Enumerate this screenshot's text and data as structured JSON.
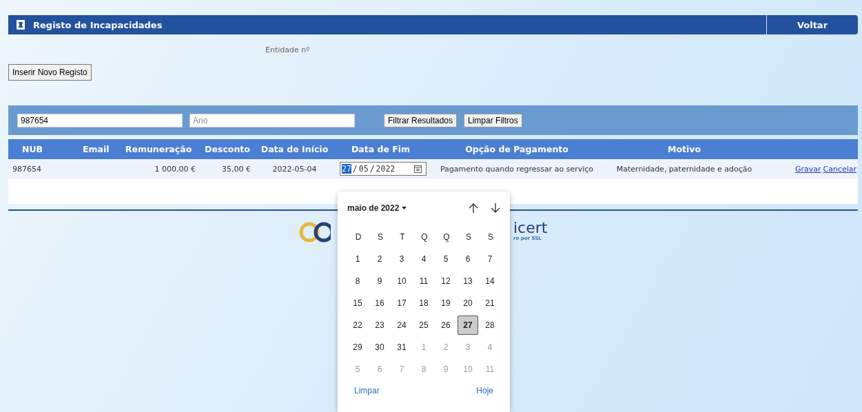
{
  "header": {
    "title": "Registo de Incapacidades",
    "back": "Voltar"
  },
  "entity_label": "Entidade nº",
  "new_button": "Inserir Novo Registo",
  "filters": {
    "nub_value": "987654",
    "year_placeholder": "Ano",
    "buttons": [
      "Filtrar Resultados",
      "Limpar Filtros"
    ]
  },
  "table": {
    "columns": [
      "NUB",
      "Email",
      "Remuneração",
      "Desconto",
      "Data de Início",
      "Data de Fim",
      "Opção de Pagamento",
      "Motivo"
    ],
    "row": {
      "nub": "987654",
      "remuneration": "1 000,00 €",
      "discount": "35,00 €",
      "start": "2022-05-04",
      "end_parts": [
        {
          "text": "27",
          "selected": true
        },
        {
          "text": "/",
          "selected": false
        },
        {
          "text": "05",
          "selected": false
        },
        {
          "text": "/",
          "selected": false
        },
        {
          "text": "2022",
          "selected": false
        }
      ],
      "payment": "Pagamento quando regressar ao serviço",
      "reason": "Maternidade, paternidade e adoção",
      "actions": [
        "Gravar",
        "Cancelar"
      ]
    }
  },
  "footer": {
    "seal_text": "icert",
    "seal_caption": "ro por SSL"
  },
  "calendar": {
    "month": "maio de 2022",
    "weekdays": [
      "D",
      "S",
      "T",
      "Q",
      "Q",
      "S",
      "S"
    ],
    "days": [
      {
        "day": "1",
        "muted": false,
        "selected": false
      },
      {
        "day": "2",
        "muted": false,
        "selected": false
      },
      {
        "day": "3",
        "muted": false,
        "selected": false
      },
      {
        "day": "4",
        "muted": false,
        "selected": false
      },
      {
        "day": "5",
        "muted": false,
        "selected": false
      },
      {
        "day": "6",
        "muted": false,
        "selected": false
      },
      {
        "day": "7",
        "muted": false,
        "selected": false
      },
      {
        "day": "8",
        "muted": false,
        "selected": false
      },
      {
        "day": "9",
        "muted": false,
        "selected": false
      },
      {
        "day": "10",
        "muted": false,
        "selected": false
      },
      {
        "day": "11",
        "muted": false,
        "selected": false
      },
      {
        "day": "12",
        "muted": false,
        "selected": false
      },
      {
        "day": "13",
        "muted": false,
        "selected": false
      },
      {
        "day": "14",
        "muted": false,
        "selected": false
      },
      {
        "day": "15",
        "muted": false,
        "selected": false
      },
      {
        "day": "16",
        "muted": false,
        "selected": false
      },
      {
        "day": "17",
        "muted": false,
        "selected": false
      },
      {
        "day": "18",
        "muted": false,
        "selected": false
      },
      {
        "day": "19",
        "muted": false,
        "selected": false
      },
      {
        "day": "20",
        "muted": false,
        "selected": false
      },
      {
        "day": "21",
        "muted": false,
        "selected": false
      },
      {
        "day": "22",
        "muted": false,
        "selected": false
      },
      {
        "day": "23",
        "muted": false,
        "selected": false
      },
      {
        "day": "24",
        "muted": false,
        "selected": false
      },
      {
        "day": "25",
        "muted": false,
        "selected": false
      },
      {
        "day": "26",
        "muted": false,
        "selected": false
      },
      {
        "day": "27",
        "muted": false,
        "selected": true
      },
      {
        "day": "28",
        "muted": false,
        "selected": false
      },
      {
        "day": "29",
        "muted": false,
        "selected": false
      },
      {
        "day": "30",
        "muted": false,
        "selected": false
      },
      {
        "day": "31",
        "muted": false,
        "selected": false
      },
      {
        "day": "1",
        "muted": true,
        "selected": false
      },
      {
        "day": "2",
        "muted": true,
        "selected": false
      },
      {
        "day": "3",
        "muted": true,
        "selected": false
      },
      {
        "day": "4",
        "muted": true,
        "selected": false
      },
      {
        "day": "5",
        "muted": true,
        "selected": false
      },
      {
        "day": "6",
        "muted": true,
        "selected": false
      },
      {
        "day": "7",
        "muted": true,
        "selected": false
      },
      {
        "day": "8",
        "muted": true,
        "selected": false
      },
      {
        "day": "9",
        "muted": true,
        "selected": false
      },
      {
        "day": "10",
        "muted": true,
        "selected": false
      },
      {
        "day": "11",
        "muted": true,
        "selected": false
      }
    ],
    "clear": "Limpar",
    "today": "Hoje"
  }
}
